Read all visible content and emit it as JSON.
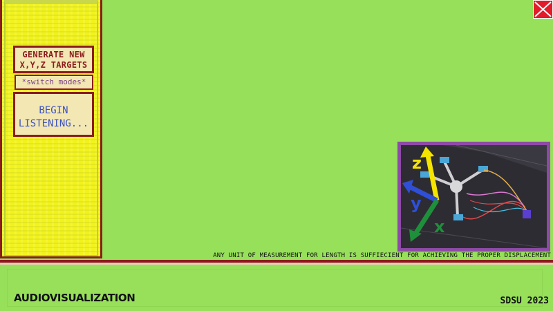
{
  "close_button": {
    "icon": "close-x-icon",
    "color": "#e21c2a"
  },
  "sidebar": {
    "generate_button": {
      "line1": "GENERATE NEW",
      "line2": "X,Y,Z TARGETS"
    },
    "switch_button": {
      "label": "*switch modes*"
    },
    "listen_button": {
      "line1": "BEGIN",
      "line2": "LISTENING..."
    }
  },
  "diagram": {
    "axis_labels": {
      "x": "x",
      "y": "y",
      "z": "z"
    },
    "axis_colors": {
      "x": "#1e8f3a",
      "y": "#2f4fd6",
      "z": "#f5e400"
    }
  },
  "note": "ANY UNIT OF MEASUREMENT FOR LENGTH IS SUFFIECIENT FOR ACHIEVING THE PROPER DISPLACEMENT",
  "footer": {
    "title": "AUDIOVISUALIZATION",
    "credit": "SDSU 2023"
  },
  "colors": {
    "background": "#96e05a",
    "sidebar": "#f2f21c",
    "border": "#8b1c1c",
    "frame": "#8d4aa6"
  }
}
